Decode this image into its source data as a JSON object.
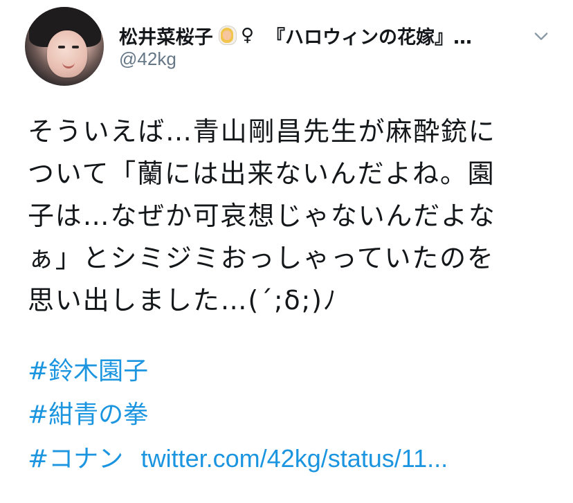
{
  "profile": {
    "display_name": "松井菜桜子",
    "emoji_icon": "bride-with-veil-icon",
    "female_sign": "♀",
    "name_suffix": "『ハロウィンの花嫁』…",
    "handle": "@42kg",
    "menu_icon": "chevron-down-icon"
  },
  "tweet": {
    "lines": [
      "そういえば…青山剛昌先生が麻酔銃に",
      "ついて「蘭には出来ないんだよね。園",
      "子は…なぜか可哀想じゃないんだよな",
      "ぁ」とシミジミおっしゃっていたのを",
      "思い出しました…(´;δ;)ﾉ"
    ],
    "hashtags": [
      "#鈴木園子",
      "#紺青の拳",
      "#コナン"
    ],
    "status_link": "twitter.com/42kg/status/11..."
  },
  "colors": {
    "text": "#14171a",
    "secondary": "#657786",
    "link": "#1b95e0",
    "background": "#ffffff"
  }
}
